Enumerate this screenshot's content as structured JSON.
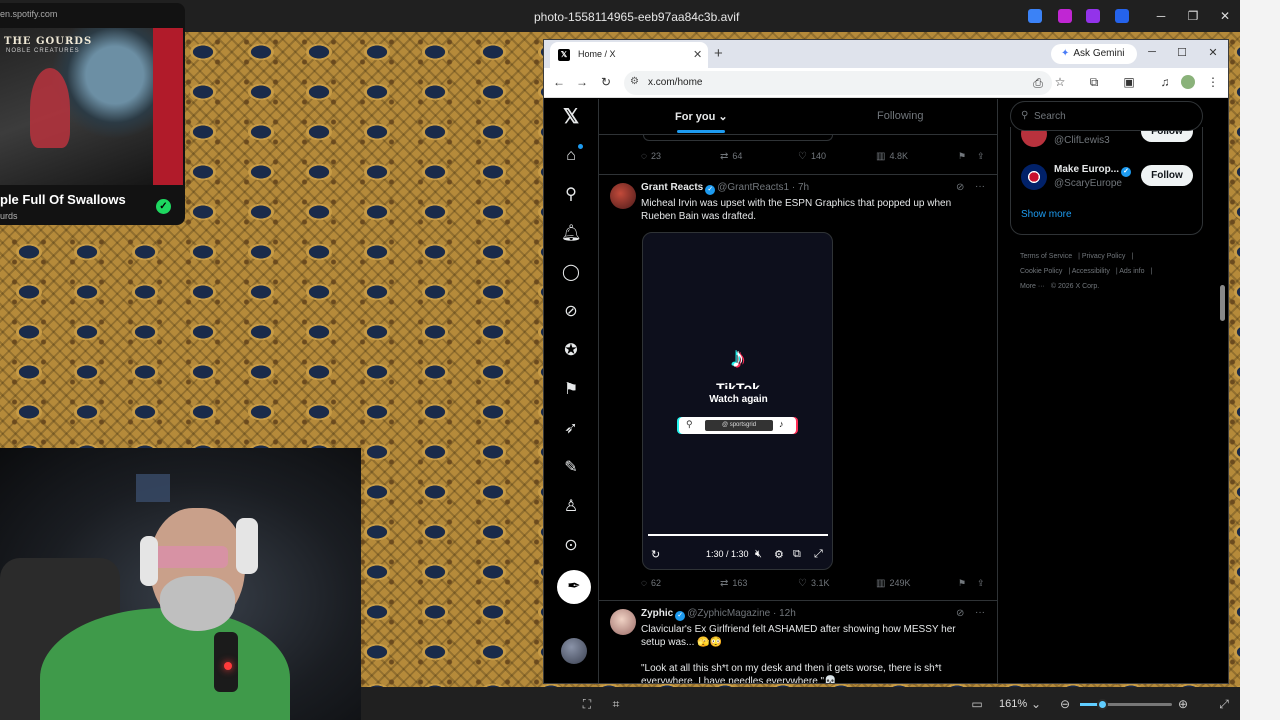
{
  "viewer": {
    "title": "photo-1558114965-eeb97aa84c3b.avif",
    "zoom": "161%",
    "zoom_fraction": 0.24
  },
  "spotify": {
    "url": "en.spotify.com",
    "album_band": "THE GOURDS",
    "album_subtitle": "NOBLE CREATURES",
    "song_title": "ple Full Of Swallows",
    "artist": "urds"
  },
  "browser": {
    "tab_title": "Home / X",
    "gemini_label": "Ask Gemini",
    "url": "x.com/home"
  },
  "x": {
    "tabs": {
      "for_you": "For you",
      "following": "Following"
    },
    "prev_post_stats": {
      "replies": "23",
      "reposts": "64",
      "likes": "140",
      "views": "4.8K"
    },
    "post1": {
      "name": "Grant Reacts",
      "handle": "@GrantReacts1 · 7h",
      "text": "Micheal Irvin was upset with the ESPN Graphics that popped up when Rueben Bain was drafted.",
      "media": {
        "brand": "TikTok",
        "overlay": "Watch again",
        "search_text": "@ sportsgrid",
        "time": "1:30 / 1:30"
      },
      "stats": {
        "replies": "62",
        "reposts": "163",
        "likes": "3.1K",
        "views": "249K"
      }
    },
    "post2": {
      "name": "Zyphic",
      "handle": "@ZyphicMagazine · 12h",
      "text1": "Clavicular's Ex Girlfriend felt ASHAMED after showing how MESSY her setup was... 🫣😳",
      "text2": "\"Look at all this sh*t on my desk and then it gets worse, there is sh*t everywhere, I have needles everywhere.\"💀"
    },
    "search_placeholder": "Search",
    "who_to_follow": [
      {
        "name": "",
        "handle": "@ClifLewis3",
        "button": "Follow"
      },
      {
        "name": "Make Europ...",
        "handle": "@ScaryEurope",
        "button": "Follow"
      }
    ],
    "show_more": "Show more",
    "footer": [
      "Terms of Service",
      "Privacy Policy",
      "Cookie Policy",
      "Accessibility",
      "Ads info",
      "More ···",
      "© 2026 X Corp."
    ]
  }
}
